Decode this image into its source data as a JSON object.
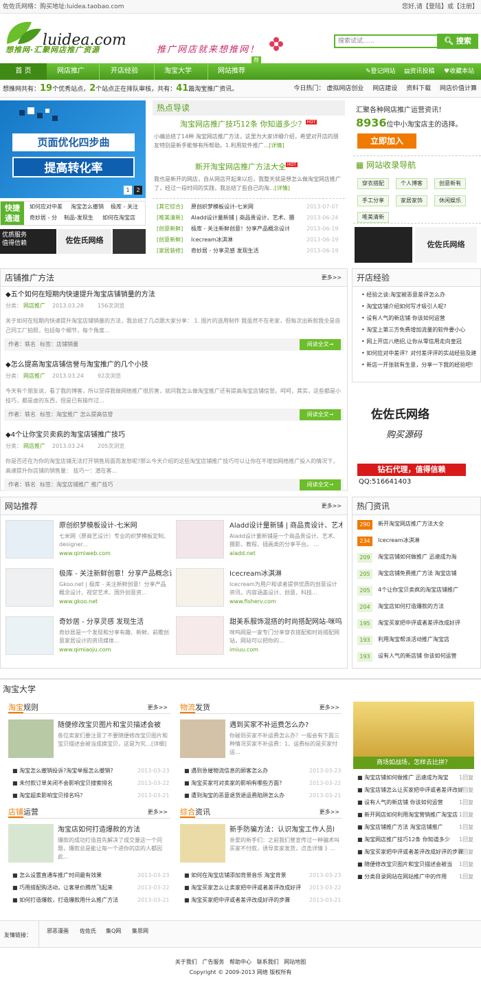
{
  "topbar": {
    "left": "佐佐氏网络：购买地址:luidea.taobao.com",
    "right_prefix": "您好,请",
    "login": "登陆",
    "or": "或",
    "register": "注册"
  },
  "logo": {
    "text": "luidea.com",
    "slogan": "想推网·汇聚网店推广资源",
    "banner": "推广网店就来想推网！",
    "badge": "荐"
  },
  "search": {
    "placeholder": "搜索试试......",
    "button": "搜索"
  },
  "nav": {
    "items": [
      "首 页",
      "网店推广",
      "开店经验",
      "淘宝大学",
      "网站推荐"
    ],
    "right": [
      "登记网站",
      "资讯投稿",
      "收藏本站"
    ]
  },
  "stat": {
    "t1": "想推网共有：",
    "n1": "19",
    "t2": "个优秀站点，",
    "n2": "2",
    "t3": "个站点正在排队审核，共有：",
    "n3": "41",
    "t4": "篇淘宝推广资讯。",
    "hot_label": "今日热门：",
    "hot": [
      "虚拟网店创业",
      "网店建设",
      "资料下载",
      "网店价值计算"
    ]
  },
  "slide": {
    "line1": "页面优化四步曲",
    "line2": "提高转化率",
    "p1": "1",
    "p2": "2"
  },
  "quick": {
    "label1": "快捷",
    "label2": "通道",
    "links": [
      "如何应对中差",
      "淘宝怎么撤销",
      "极库 - 关注",
      "奇妙居 - 分",
      "制品-发现生",
      "如何在淘宝店"
    ]
  },
  "ads": {
    "a1": "优质服务",
    "a2": "佐佐氏网络",
    "a1b": "值得信赖"
  },
  "hotread": {
    "title": "热点导读",
    "h1": "淘宝网店推广技巧12条 你知道多少？",
    "h1_tag": "HOT",
    "d1": "小编总结了14种 淘宝网店推广方法，这里为大家详细介绍，希望对开店的朋友特别是新手能够有所帮助。1.利用软件推广...",
    "d1_more": "[详情]",
    "h2": "新开淘宝网店推广方法大全",
    "h2_tag": "HOT",
    "d2": "我也是新开的网店，自从网店开起来以后，我整天就是想怎么做淘宝网店推广了，经过一段时间的实践，我总结了些自己的淘...",
    "d2_more": "[详情]",
    "list": [
      {
        "c": "[其它综合]",
        "t": "原创织梦模板设计-七米网",
        "d": "2013-07-07"
      },
      {
        "c": "[唯美清新]",
        "t": "Aladd设计量新铺 | 商品贵设计、艺术、摄",
        "d": "2013-06-24"
      },
      {
        "c": "[创意新鲜]",
        "t": "极库 - 关注新鲜创意！分享产品概念设计",
        "d": "2013-06-19"
      },
      {
        "c": "[创意新鲜]",
        "t": "Icecream冰淇淋",
        "d": "2013-06-19"
      },
      {
        "c": "[家居装修]",
        "t": "奇妙居 - 分享灵感 发现生活",
        "d": "2013-06-19"
      }
    ]
  },
  "righttop": {
    "line1": "汇聚各种网店推广运营资讯！",
    "count": "8936",
    "line2": "位中小淘宝店主的选择。",
    "join": "立即加入",
    "nav_title": "网站收录导航",
    "tags": [
      "穿衣搭配",
      "个人博客",
      "创意新有",
      "手工分享",
      "家居家饰",
      "休闲娱乐",
      "唯美清新"
    ],
    "ad": "佐佐氏网络"
  },
  "shop": {
    "title": "店铺推广方法",
    "more": "更多>>",
    "articles": [
      {
        "t": "◆五个如何在短期内快速提升淘宝店铺销量的方法",
        "cat_label": "分类：",
        "cat": "网店推广",
        "date": "2013.03.28",
        "views": "156次浏览",
        "desc": "关于如何在短期内快速提升淘宝店铺销量的方法，我总结了几点跟大家分享： 1. 图片的选用制作 我虽然不在老家，但每次出新款我全是自己同工厂拍照，包括每个细节，每个角度...",
        "author": "作者：轶名",
        "tag": "标签：店铺销量",
        "read": "阅读全文→"
      },
      {
        "t": "◆怎么提高淘宝店铺信誉与淘宝推广的几个小技",
        "cat_label": "分类：",
        "cat": "网店推广",
        "date": "2013.03.24",
        "views": "92次浏览",
        "desc": "今天有个朋友说，看了我的博客，所以觉得我做网络推广很厉害，就问我怎么做淘宝推广还有提高淘宝店铺信誉。呵呵，其实，这些都是小技巧，都是虚的东西，但是已有操作过...",
        "author": "作者：轶名",
        "tag": "标签：淘宝推广  怎么提高信誉",
        "read": "阅读全文→"
      },
      {
        "t": "◆4个让你宝贝卖疯的淘宝店铺推广技巧",
        "cat_label": "分类：",
        "cat": "网店推广",
        "date": "2013.03.24",
        "views": "205次浏览",
        "desc": "你是否还在为你的淘宝店铺无法打开销售局面而发愁呢?那么今天介绍的这些淘宝店铺推广技巧可以让你在不增加网络推广投入的情况下，高速提升你店铺的销售量： 技巧一：潜在客...",
        "author": "作者：轶名",
        "tag": "标签：淘宝店铺推广  推广技巧",
        "read": "阅读全文→"
      }
    ]
  },
  "exp": {
    "title": "开店经验",
    "items": [
      "经验之谈:淘宝被恶意差评怎么办",
      "淘宝店铺介绍如何写才吸引人呢?",
      "设有人气的新店铺 你该如何运营",
      "淘宝上第三方免费增加流量的软件要小心",
      "网上开店八绝招,让你从零信用走向皇冠",
      "如何应对中差评？对付差评评的实战经验及建",
      "新店一开张就有生意，分享一下我的经验吧!"
    ],
    "ad_t1": "佐佐氏网络",
    "ad_t2": "购买源码",
    "ad_t3": "钻石代理，值得信赖",
    "ad_qq": "QQ:516641403"
  },
  "sites": {
    "title": "网站推荐",
    "more": "更多>>",
    "items": [
      {
        "t": "原创织梦模板设计-七米网",
        "d": "七米网（原商艺设计）专业的织梦模板定制、designer...",
        "u": "www.qimiweb.com"
      },
      {
        "t": "Aladd设计量新铺 | 商品贵设计、艺术、摄影",
        "d": "Aladd设计量新铺是一个商品贵设计、艺术、摄影、教程、插画类的分享平台。 ...",
        "u": "aladd.net"
      },
      {
        "t": "极库 - 关注新鲜创意！分享产品概念设",
        "d": "Gkoo.net | 极库 - 关注新鲜创意！分享产品概念设计、视觉艺术、国外创意资...",
        "u": "www.gkoo.net"
      },
      {
        "t": "Icecream冰淇淋",
        "d": "Icecream为用户和读者提供优质的创意设计资讯，内容涵盖设计、创意、科技...",
        "u": "www.fisherv.com"
      },
      {
        "t": "奇妙居 - 分享灵感 发现生活",
        "d": "奇妙居是一个发现和分享有趣、新鲜、前瞻创意家居设计的资讯媒体...",
        "u": "www.qimiaoju.com"
      },
      {
        "t": "甜美系服饰混搭的时尚搭配网站-咪呜网",
        "d": "咪呜网是一家专门分享穿衣搭配和时尚搭配网站，网站可以把你的...",
        "u": "imiuu.com"
      }
    ]
  },
  "news": {
    "title": "热门资讯",
    "items": [
      {
        "n": "290",
        "t": "新开淘宝网店推广方法大全"
      },
      {
        "n": "234",
        "t": "Icecream冰淇淋"
      },
      {
        "n": "209",
        "t": "淘宝店铺如何做推广 迅速成为淘"
      },
      {
        "n": "205",
        "t": "淘宝店铺免费推广方法 淘宝店铺"
      },
      {
        "n": "205",
        "t": "4个让你宝贝卖疯的淘宝店铺推广"
      },
      {
        "n": "204",
        "t": "淘宝店如何打造爆款的方法"
      },
      {
        "n": "195",
        "t": "淘宝买家把中评或者差评改成好评"
      },
      {
        "n": "193",
        "t": "利用淘宝帮派活动推广淘宝店"
      },
      {
        "n": "193",
        "t": "设有人气的新店铺 你该如何运营"
      }
    ]
  },
  "univ": {
    "title": "淘宝大学",
    "rules": {
      "hl": "淘宝",
      "hr": "规则",
      "more": "更多>>",
      "t": "随便修改宝贝图片和宝贝描述会被",
      "d": "各位卖家们要注意了不要随便修改宝贝图片和宝贝描述会被当成换宝贝，这是为究…[详细]",
      "list": [
        {
          "t": "淘宝怎么撤销投诉?淘宝举报怎么撤销?",
          "d": "2013-03-23"
        },
        {
          "t": "未付款订单关闭不会影响宝贝搜索排名",
          "d": "2013-03-22"
        },
        {
          "t": "淘宝超卖影响宝贝排名吗？",
          "d": "2013-03-21"
        }
      ]
    },
    "logi": {
      "hl": "物流",
      "hr": "发货",
      "more": "更多>>",
      "t": "遇到买家不补运费怎么办?",
      "d": "你碰到买家不补运费怎么办？一般会有下面三种情况买家不补运费：1、运费标的是买家付运...",
      "list": [
        {
          "t": "遇到急催物流信息的顾客怎么办",
          "d": "2013-03-23"
        },
        {
          "t": "淘宝买家可对卖家的影响有哪些方面?",
          "d": "2013-03-22"
        },
        {
          "t": "遭到淘宝的恶意退货退运费陷阱怎么办",
          "d": "2013-03-21"
        }
      ]
    },
    "ops": {
      "hl": "店铺",
      "hr": "运营",
      "more": "更多>>",
      "t": "淘宝店如何打造爆款的方法",
      "d": "爆款的成功打造首先解决了成交量这一个问题，爆款总是能让每一个进你的店的人都因此...",
      "list": [
        {
          "t": "怎么设置直通车推广时间最有效果",
          "d": "2013-03-23"
        },
        {
          "t": "巧用搭配购活动，让客单价腾然飞起来",
          "d": "2013-03-22"
        },
        {
          "t": "如何打造爆款，打造爆款用什么推广方法",
          "d": "2013-03-21"
        }
      ]
    },
    "info": {
      "hl": "综合",
      "hr": "资讯",
      "more": "更多>>",
      "t": "新手防骗方法：认识淘宝工作人员l",
      "d": "亲爱的新手们：之前我们曾宣传过一种骗术叫买家不付款，诱导卖家发货，点击详情 》...",
      "list": [
        {
          "t": "如何在淘宝店铺添加背景音乐 淘宝背景",
          "d": "2013-03-23"
        },
        {
          "t": "淘宝买家怎么让卖家把中评或者差评改成好评",
          "d": "2013-03-22"
        },
        {
          "t": "淘宝买家把中评或者差评改成好评的步骤",
          "d": "2013-03-21"
        }
      ]
    },
    "side_caption": "商场如战场，怎样去比拼？",
    "side_list": [
      {
        "t": "淘宝店铺如何做推广 迅速成为淘宝",
        "r": "1回复"
      },
      {
        "t": "淘宝店铺怎么让买家把中评或者差评改好",
        "r": "1回复"
      },
      {
        "t": "设有人气的新店铺 你该如何运营",
        "r": "1回复"
      },
      {
        "t": "新开网店如何利用淘宝营销推广淘宝店",
        "r": "1回复"
      },
      {
        "t": "淘宝店铺推广方法 淘宝店铺推广",
        "r": "1回复"
      },
      {
        "t": "淘宝网店推广技巧12条 你知道多少",
        "r": "1回复"
      },
      {
        "t": "淘宝买家把中评或者差评改成好评的步骤",
        "r": "1回复"
      },
      {
        "t": "随便修改宝贝图片和宝贝描述会被当",
        "r": "1回复"
      },
      {
        "t": "分类目录网站在网站推广中的作用",
        "r": "1回复"
      }
    ]
  },
  "friend": {
    "label": "友情链接：",
    "links": [
      "邪恶漫画",
      "佐佐氏",
      "集Q网",
      "集思网"
    ]
  },
  "footer": {
    "links": [
      "关于我们",
      "广告服务",
      "帮助中心",
      "联系我们",
      "网站地图"
    ],
    "copy": "Copyright © 2009-2013 网络 版权所有"
  },
  "colors": {
    "green": "#5db42c",
    "orange": "#f07a00"
  }
}
